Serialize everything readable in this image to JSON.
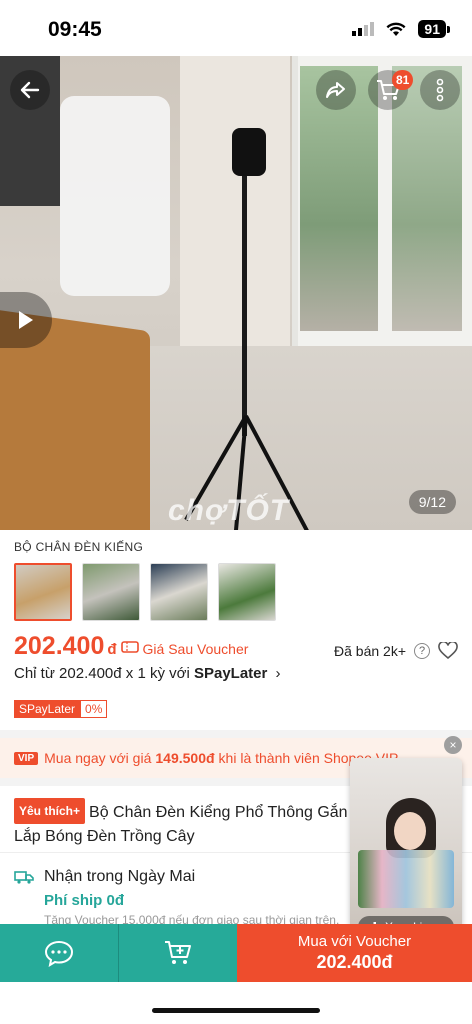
{
  "status_bar": {
    "time": "09:45",
    "battery": "91",
    "signal_icon": "signal-bars-icon",
    "wifi_icon": "wifi-icon"
  },
  "hero": {
    "back_icon": "arrow-left-icon",
    "share_icon": "share-icon",
    "cart_icon": "cart-icon",
    "cart_badge": "81",
    "more_icon": "more-vertical-icon",
    "play_icon": "play-icon",
    "watermark": "chợTỐT",
    "counter": "9/12"
  },
  "product": {
    "shop_category": "BỘ CHÂN ĐÈN KIẾNG",
    "thumbnails": [
      "thumb-1",
      "thumb-2",
      "thumb-3",
      "thumb-4"
    ],
    "price": "202.400",
    "currency": "đ",
    "voucher_label": "Giá Sau Voucher",
    "sold": "Đã bán 2k+",
    "help": "?",
    "paylater_prefix": "Chỉ từ 202.400đ x 1 kỳ với ",
    "paylater_brand": "SPayLater",
    "paylater_chevron": "›",
    "spl_tag": "SPayLater",
    "spl_rate": "0%",
    "fav_badge": "Yêu thích+",
    "title": "Bộ Chân Đèn Kiểng Phổ Thông Gắn Lắp Bóng Đèn Trồng Cây"
  },
  "vip": {
    "badge": "VIP",
    "text_before": "Mua ngay với giá",
    "amount": "149.500đ",
    "text_after": "khi là thành viên Shopee VIP"
  },
  "shipping": {
    "delivery": "Nhận trong Ngày Mai",
    "fee": "Phí ship 0đ",
    "sub": "Tặng Voucher 15.000đ nếu đơn giao sau thời gian trên."
  },
  "live": {
    "button": "Xem Live",
    "close": "×"
  },
  "bottom_bar": {
    "chat_icon": "chat-icon",
    "add_cart_icon": "add-to-cart-icon",
    "buy_line1": "Mua với Voucher",
    "buy_price": "202.400đ"
  },
  "colors": {
    "accent": "#ee4d2d",
    "teal": "#26aa99"
  }
}
